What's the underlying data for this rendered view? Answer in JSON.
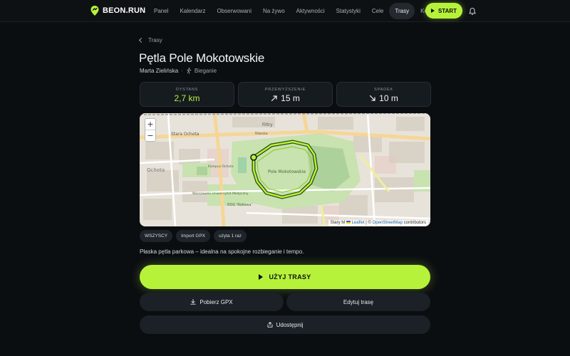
{
  "app": {
    "brand": "BEON.RUN",
    "accent": "#b7f23a"
  },
  "nav": {
    "items": [
      {
        "label": "Panel",
        "active": false
      },
      {
        "label": "Kalendarz",
        "active": false
      },
      {
        "label": "Obserwowani",
        "active": false
      },
      {
        "label": "Na żywo",
        "active": false
      },
      {
        "label": "Aktywności",
        "active": false
      },
      {
        "label": "Statystyki",
        "active": false
      },
      {
        "label": "Cele",
        "active": false
      },
      {
        "label": "Trasy",
        "active": true
      },
      {
        "label": "Konto",
        "active": false
      }
    ],
    "start_label": "START",
    "notifications_icon": "bell-icon"
  },
  "breadcrumb": {
    "label": "Trasy"
  },
  "route": {
    "title": "Pętla Pole Mokotowskie",
    "author": "Marta Zielińska",
    "sport": "Bieganie",
    "sport_icon": "runner-icon"
  },
  "stats": {
    "distance": {
      "label": "DYSTANS",
      "value": "2,7 km"
    },
    "elevation_gain": {
      "label": "PRZEWYŻSZENIE",
      "value": "15 m",
      "icon": "arrow-up-right-icon"
    },
    "descent": {
      "label": "SPADEK",
      "value": "10 m",
      "icon": "arrow-down-right-icon"
    }
  },
  "map": {
    "zoom_in": "+",
    "zoom_out": "−",
    "labels": {
      "stara_ochota": "Stara Ochota",
      "filtry": "Filtry",
      "ochota": "Ochota",
      "pole_mokotowskie": "Pole Mokotowskie",
      "niwska": "Niwska",
      "rog": "ROG 'Rokowa'",
      "kampus": "Kampus Ochota",
      "uniwersytet": "Warszawski Uniwersytet Medyczny"
    },
    "attribution": {
      "prefix": "Stary M",
      "leaflet": "Leaflet",
      "sep": "| ©",
      "osm": "OpenStreetMap",
      "suffix": "contributors"
    }
  },
  "tags": [
    "WSZYSCY",
    "Import GPX",
    "użyta 1 raz"
  ],
  "description": "Płaska pętla parkowa – idealna na spokojne rozbieganie i tempo.",
  "actions": {
    "use_route": "UŻYJ TRASY",
    "download_gpx": "Pobierz GPX",
    "edit_route": "Edytuj trasę",
    "share": "Udostępnij"
  }
}
